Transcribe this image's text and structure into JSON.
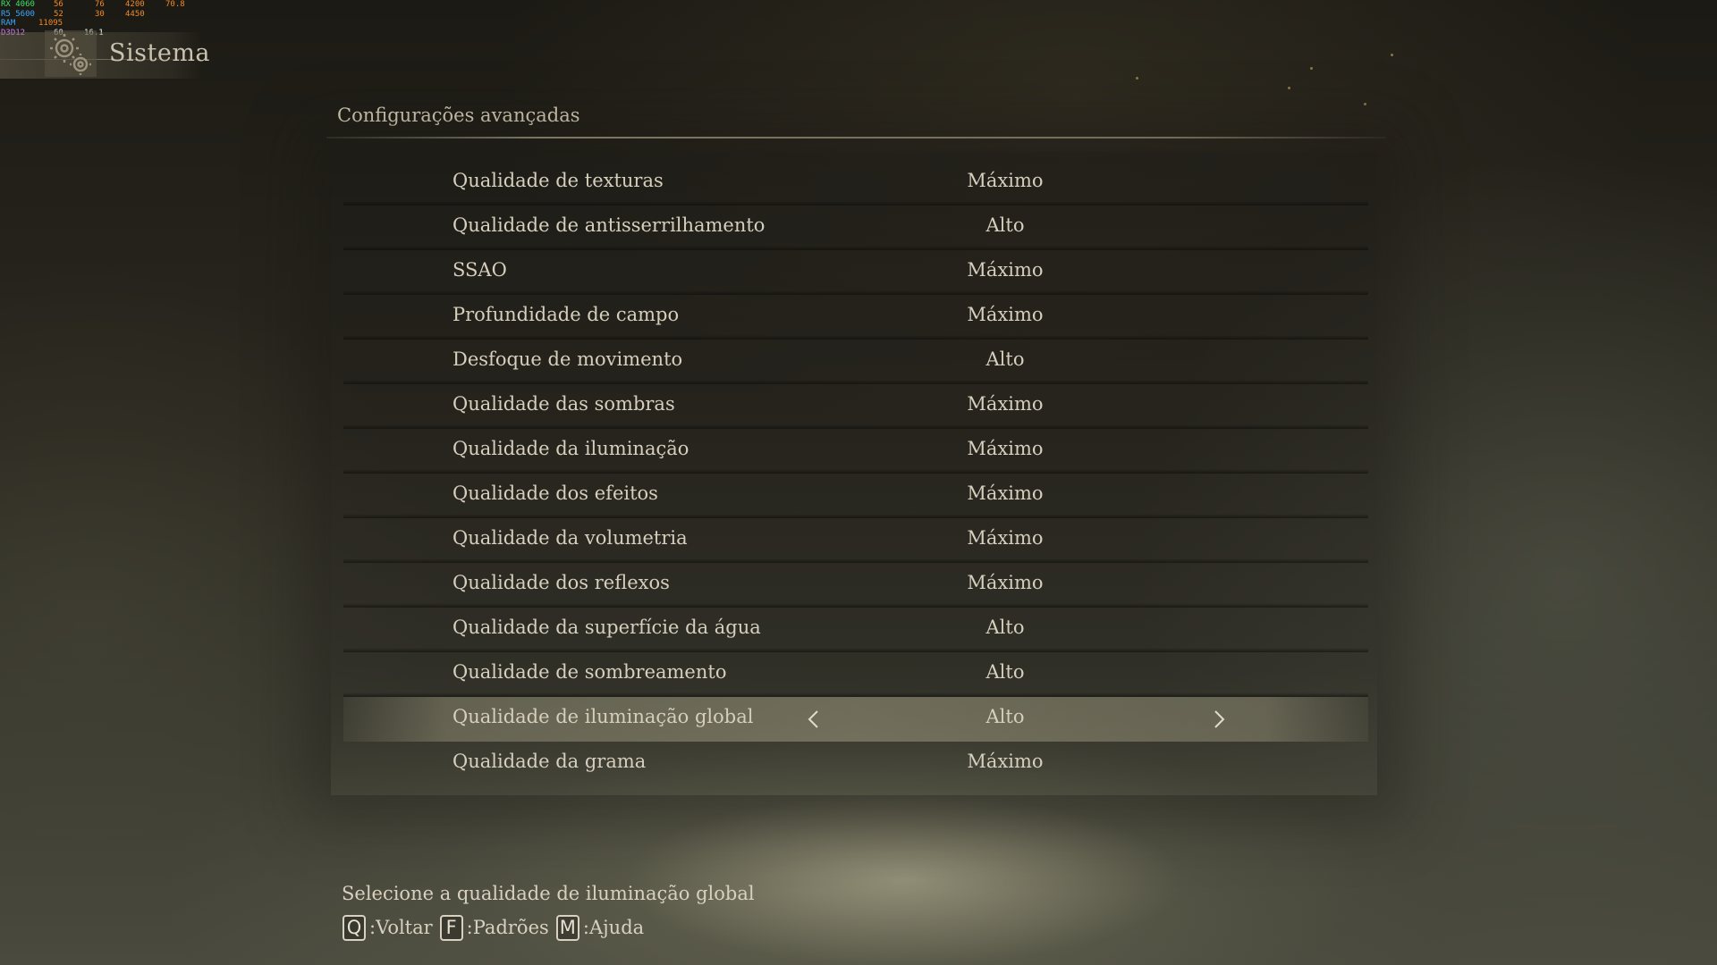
{
  "osd": {
    "gpu": {
      "label": "RX 4060",
      "temp": "56",
      "load": "76",
      "clock": "4200",
      "fps_val": "70.8"
    },
    "cpu": {
      "label": "R5 5600",
      "temp": "52",
      "load": "30",
      "clock": "4450"
    },
    "ram": {
      "label": "RAM",
      "value": "11095"
    },
    "api": {
      "label": "D3D12",
      "fps": "60",
      "frametime": "16.1"
    }
  },
  "header": {
    "title": "Sistema",
    "icon": "gear-icon"
  },
  "section": {
    "title": "Configurações avançadas"
  },
  "settings": [
    {
      "label": "Qualidade de texturas",
      "value": "Máximo"
    },
    {
      "label": "Qualidade de antisserrilhamento",
      "value": "Alto"
    },
    {
      "label": "SSAO",
      "value": "Máximo"
    },
    {
      "label": "Profundidade de campo",
      "value": "Máximo"
    },
    {
      "label": "Desfoque de movimento",
      "value": "Alto"
    },
    {
      "label": "Qualidade das sombras",
      "value": "Máximo"
    },
    {
      "label": "Qualidade da iluminação",
      "value": "Máximo"
    },
    {
      "label": "Qualidade dos efeitos",
      "value": "Máximo"
    },
    {
      "label": "Qualidade da volumetria",
      "value": "Máximo"
    },
    {
      "label": "Qualidade dos reflexos",
      "value": "Máximo"
    },
    {
      "label": "Qualidade da superfície da água",
      "value": "Alto"
    },
    {
      "label": "Qualidade de sombreamento",
      "value": "Alto"
    },
    {
      "label": "Qualidade de iluminação global",
      "value": "Alto",
      "selected": true
    },
    {
      "label": "Qualidade da grama",
      "value": "Máximo"
    }
  ],
  "footer": {
    "help_text": "Selecione a qualidade de iluminação global",
    "controls": [
      {
        "key": "Q",
        "label": ":Voltar"
      },
      {
        "key": "F",
        "label": ":Padrões"
      },
      {
        "key": "M",
        "label": ":Ajuda"
      }
    ]
  },
  "colors": {
    "text": "#d6cfbd",
    "selected_row": "#96927a",
    "osd_orange": "#f08a28",
    "osd_green": "#3fe06a",
    "osd_blue": "#39a8ff"
  }
}
